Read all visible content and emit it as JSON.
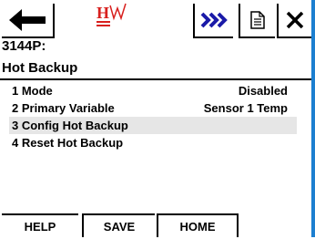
{
  "toolbar": {
    "back_icon": "left-arrow-icon",
    "logo_icon": "hart-logo-icon",
    "next_icon": "fast-forward-icon",
    "doc_icon": "document-icon",
    "close_icon": "close-x-icon"
  },
  "header": {
    "device": "3144P:",
    "title": "Hot Backup"
  },
  "menu": [
    {
      "label": "1 Mode",
      "value": "Disabled",
      "selected": false
    },
    {
      "label": "2 Primary Variable",
      "value": "Sensor 1 Temp",
      "selected": false
    },
    {
      "label": "3 Config Hot Backup",
      "value": "",
      "selected": true
    },
    {
      "label": "4 Reset Hot Backup",
      "value": "",
      "selected": false
    }
  ],
  "footer": {
    "help": "HELP",
    "save": "SAVE",
    "home": "HOME"
  },
  "colors": {
    "accent": "#1c7fd0",
    "logo_red": "#d8201e",
    "selection": "#e6e6e6"
  }
}
